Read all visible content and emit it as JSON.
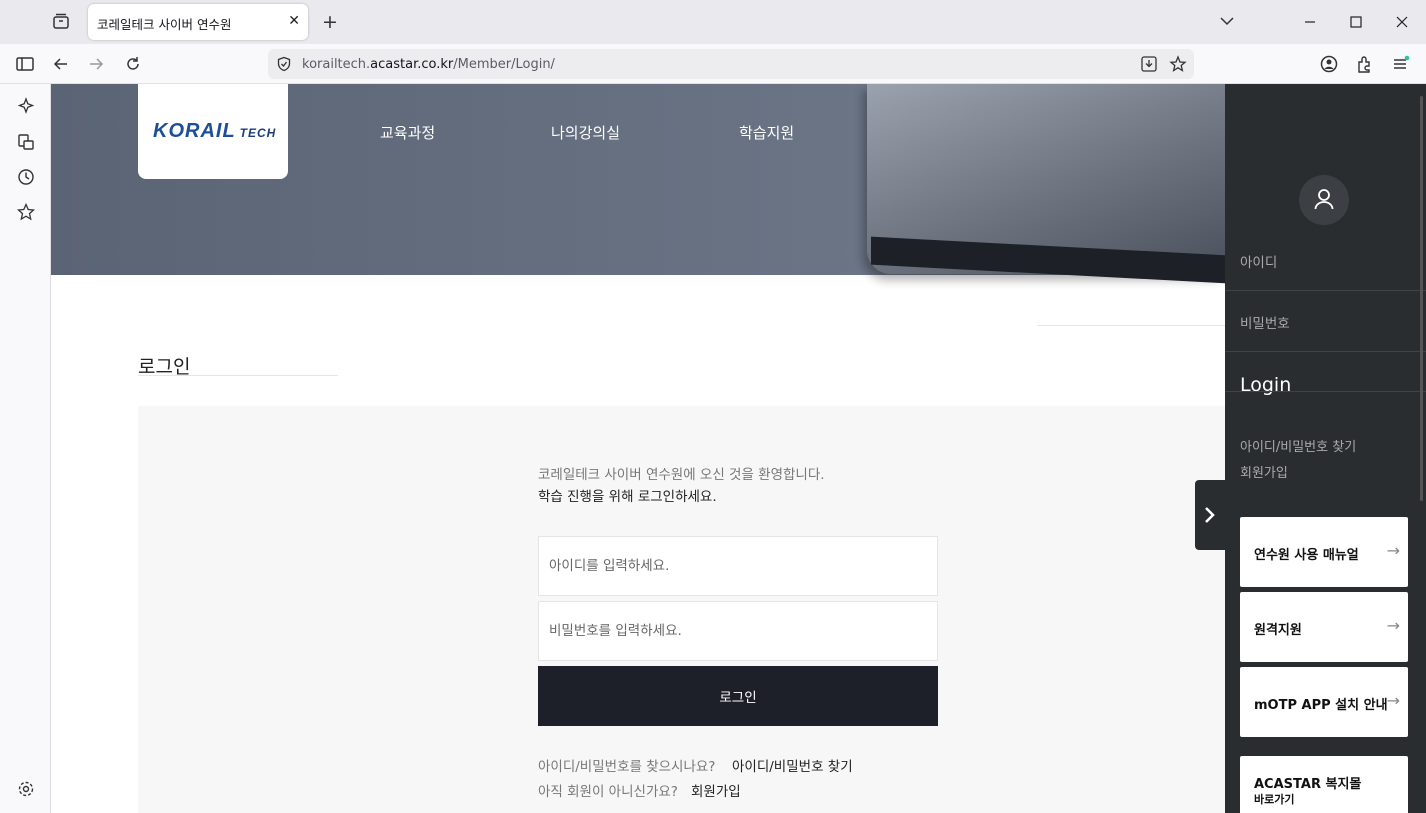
{
  "browser": {
    "tab_title": "코레일테크 사이버 연수원",
    "url_prefix": "korailtech.",
    "url_domain": "acastar.co.kr",
    "url_path": "/Member/Login/"
  },
  "site": {
    "logo_text": "KORAIL",
    "logo_sub": "TECH",
    "nav": [
      "교육과정",
      "나의강의실",
      "학습지원"
    ],
    "page_title": "로그인"
  },
  "login": {
    "welcome_1": "코레일테크 사이버 연수원에 오신 것을 환영합니다.",
    "welcome_2": "학습 진행을 위해 로그인하세요.",
    "id_placeholder": "아이디를 입력하세요.",
    "pw_placeholder": "비밀번호를 입력하세요.",
    "button": "로그인",
    "find_question": "아이디/비밀번호를 찾으시나요?",
    "find_link": "아이디/비밀번호 찾기",
    "join_question": "아직 회원이 아니신가요?",
    "join_link": "회원가입"
  },
  "quick_panel": {
    "id_label": "아이디",
    "pw_label": "비밀번호",
    "login": "Login",
    "find_link": "아이디/비밀번호 찾기",
    "join_link": "회원가입",
    "cards": [
      {
        "label": "연수원 사용 매뉴얼",
        "sub": ""
      },
      {
        "label": "원격지원",
        "sub": ""
      },
      {
        "label": "mOTP APP 설치 안내",
        "sub": ""
      },
      {
        "label": "ACASTAR 복지몰",
        "sub": "바로가기"
      }
    ]
  }
}
